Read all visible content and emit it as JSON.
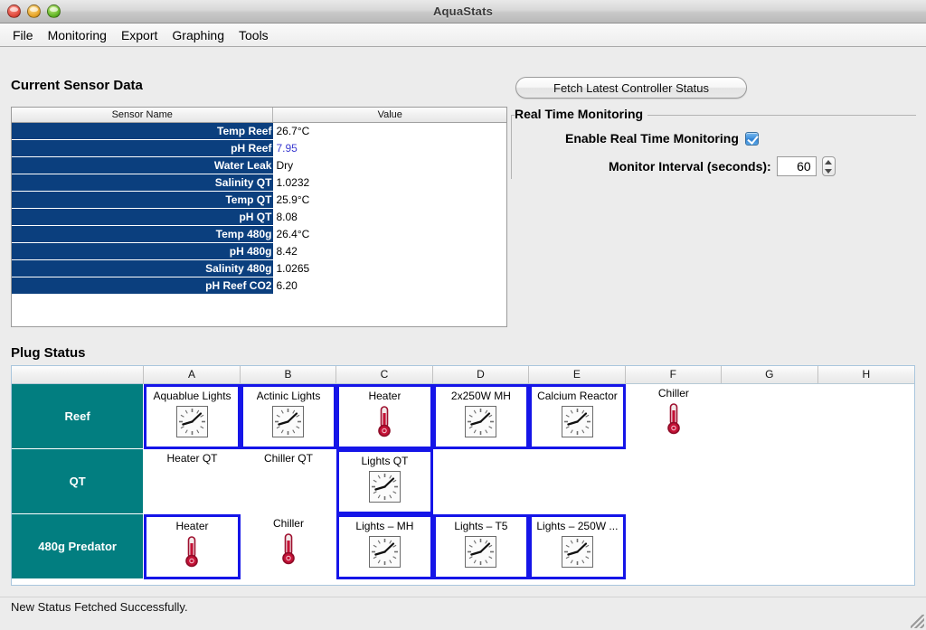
{
  "window": {
    "title": "AquaStats",
    "lights": [
      "close-button",
      "minimize-button",
      "zoom-button"
    ]
  },
  "menubar": {
    "items": [
      "File",
      "Monitoring",
      "Export",
      "Graphing",
      "Tools"
    ]
  },
  "sensor_panel": {
    "heading": "Current Sensor Data",
    "columns": [
      "Sensor Name",
      "Value"
    ],
    "rows": [
      {
        "name": "Temp Reef",
        "value": "26.7°C",
        "accent": false
      },
      {
        "name": "pH Reef",
        "value": "7.95",
        "accent": true
      },
      {
        "name": "Water Leak",
        "value": "Dry",
        "accent": false
      },
      {
        "name": "Salinity QT",
        "value": "1.0232",
        "accent": false
      },
      {
        "name": "Temp QT",
        "value": "25.9°C",
        "accent": false
      },
      {
        "name": "pH QT",
        "value": "8.08",
        "accent": false
      },
      {
        "name": "Temp 480g",
        "value": "26.4°C",
        "accent": false
      },
      {
        "name": "pH 480g",
        "value": "8.42",
        "accent": false
      },
      {
        "name": "Salinity 480g",
        "value": "1.0265",
        "accent": false
      },
      {
        "name": "pH Reef CO2",
        "value": "6.20",
        "accent": false
      }
    ],
    "header_bg": "#0b3f7e",
    "accent_value_color": "#3b3bd0"
  },
  "toolbar": {
    "fetch_label": "Fetch Latest Controller Status"
  },
  "realtime": {
    "legend": "Real Time Monitoring",
    "enable_label": "Enable Real Time Monitoring",
    "enable_checked": true,
    "interval_label": "Monitor Interval (seconds):",
    "interval_value": "60"
  },
  "plug_panel": {
    "heading": "Plug Status",
    "corner_label": "",
    "columns": [
      "A",
      "B",
      "C",
      "D",
      "E",
      "F",
      "G",
      "H"
    ],
    "row_header_color": "#027e80",
    "selected_border_color": "#1515e8",
    "rows": [
      {
        "label": "Reef",
        "cells": [
          {
            "label": "Aquablue Lights",
            "icon": "clock-icon",
            "selected": true
          },
          {
            "label": "Actinic Lights",
            "icon": "clock-icon",
            "selected": true
          },
          {
            "label": "Heater",
            "icon": "thermometer-icon",
            "selected": true
          },
          {
            "label": "2x250W MH",
            "icon": "clock-icon",
            "selected": true
          },
          {
            "label": "Calcium Reactor",
            "icon": "clock-icon",
            "selected": true
          },
          {
            "label": "Chiller",
            "icon": "thermometer-icon",
            "selected": false
          },
          {
            "label": "",
            "icon": "none",
            "selected": false
          },
          {
            "label": "",
            "icon": "none",
            "selected": false
          }
        ]
      },
      {
        "label": "QT",
        "cells": [
          {
            "label": "Heater QT",
            "icon": "none",
            "selected": false
          },
          {
            "label": "Chiller QT",
            "icon": "none",
            "selected": false
          },
          {
            "label": "Lights QT",
            "icon": "clock-icon",
            "selected": true
          },
          {
            "label": "",
            "icon": "none",
            "selected": false
          },
          {
            "label": "",
            "icon": "none",
            "selected": false
          },
          {
            "label": "",
            "icon": "none",
            "selected": false
          },
          {
            "label": "",
            "icon": "none",
            "selected": false
          },
          {
            "label": "",
            "icon": "none",
            "selected": false
          }
        ]
      },
      {
        "label": "480g Predator",
        "cells": [
          {
            "label": "Heater",
            "icon": "thermometer-icon",
            "selected": true
          },
          {
            "label": "Chiller",
            "icon": "thermometer-icon",
            "selected": false
          },
          {
            "label": "Lights – MH",
            "icon": "clock-icon",
            "selected": true
          },
          {
            "label": "Lights – T5",
            "icon": "clock-icon",
            "selected": true
          },
          {
            "label": "Lights – 250W ...",
            "icon": "clock-icon",
            "selected": true
          },
          {
            "label": "",
            "icon": "none",
            "selected": false
          },
          {
            "label": "",
            "icon": "none",
            "selected": false
          },
          {
            "label": "",
            "icon": "none",
            "selected": false
          }
        ]
      }
    ]
  },
  "statusbar": {
    "message": "New Status Fetched Successfully."
  }
}
